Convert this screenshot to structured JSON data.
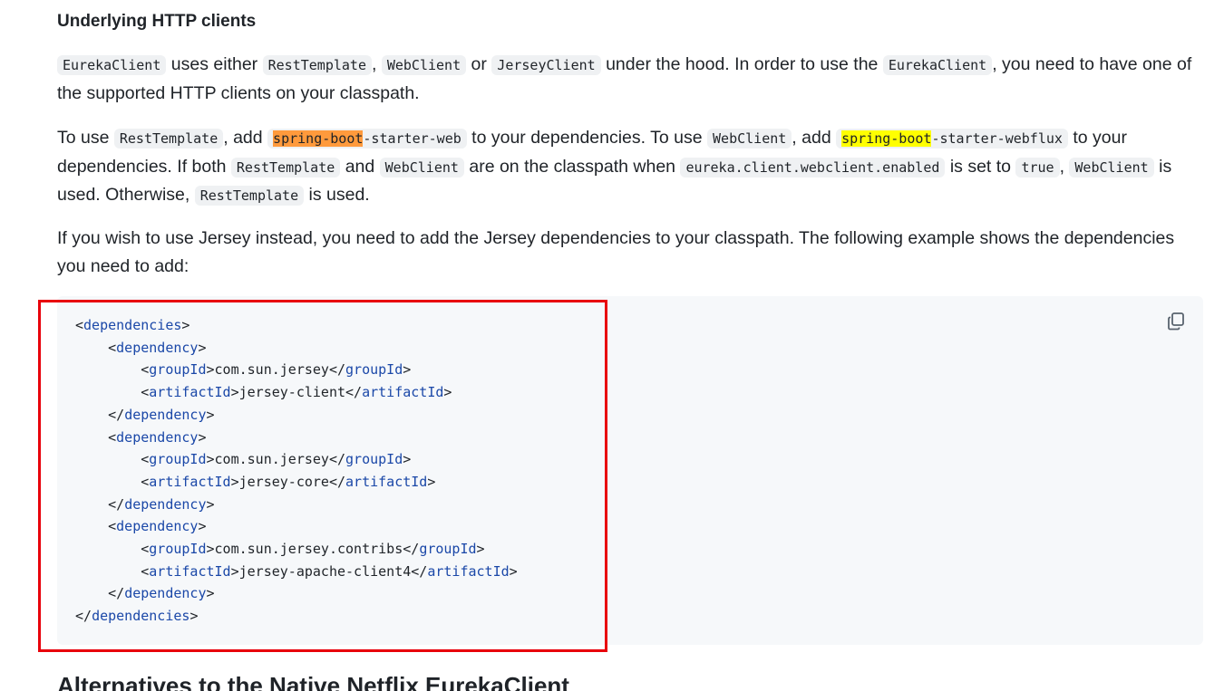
{
  "section_heading": "Underlying HTTP clients",
  "para1": {
    "code_eureka_client": "EurekaClient",
    "t1": " uses either ",
    "code_rest_template": "RestTemplate",
    "t2": ", ",
    "code_web_client": "WebClient",
    "t3": " or ",
    "code_jersey_client": "JerseyClient",
    "t4": " under the hood. In order to use the ",
    "code_eureka_client2": "EurekaClient",
    "t5": ", you need to have one of the supported HTTP clients on your classpath."
  },
  "para2": {
    "t1": "To use ",
    "code_rest_template": "RestTemplate",
    "t2": ", add ",
    "code_web_hl": "spring-boot",
    "code_web_rest": "-starter-web",
    "t3": " to your dependencies. To use ",
    "code_web_client": "WebClient",
    "t4": ", add ",
    "code_webflux_hl": "spring-boot",
    "code_webflux_rest": "-starter-webflux",
    "t5": " to your dependencies. If both ",
    "code_rest_template2": "RestTemplate",
    "t6": " and ",
    "code_web_client2": "WebClient",
    "t7": " are on the classpath when ",
    "code_property": "eureka.client.webclient.enabled",
    "t8": " is set to ",
    "code_true": "true",
    "t9": ", ",
    "code_web_client3": "WebClient",
    "t10": " is used. Otherwise, ",
    "code_rest_template3": "RestTemplate",
    "t11": " is used."
  },
  "para3": "If you wish to use Jersey instead, you need to add the Jersey dependencies to your classpath. The following example shows the dependencies you need to add:",
  "code_block": {
    "lines": [
      {
        "indent": "",
        "open": "<",
        "tag": "dependencies",
        "close": ">",
        "text": "",
        "open2": "",
        "tag2": "",
        "close2": ""
      },
      {
        "indent": "    ",
        "open": "<",
        "tag": "dependency",
        "close": ">",
        "text": "",
        "open2": "",
        "tag2": "",
        "close2": ""
      },
      {
        "indent": "        ",
        "open": "<",
        "tag": "groupId",
        "close": ">",
        "text": "com.sun.jersey",
        "open2": "</",
        "tag2": "groupId",
        "close2": ">"
      },
      {
        "indent": "        ",
        "open": "<",
        "tag": "artifactId",
        "close": ">",
        "text": "jersey-client",
        "open2": "</",
        "tag2": "artifactId",
        "close2": ">"
      },
      {
        "indent": "    ",
        "open": "</",
        "tag": "dependency",
        "close": ">",
        "text": "",
        "open2": "",
        "tag2": "",
        "close2": ""
      },
      {
        "indent": "    ",
        "open": "<",
        "tag": "dependency",
        "close": ">",
        "text": "",
        "open2": "",
        "tag2": "",
        "close2": ""
      },
      {
        "indent": "        ",
        "open": "<",
        "tag": "groupId",
        "close": ">",
        "text": "com.sun.jersey",
        "open2": "</",
        "tag2": "groupId",
        "close2": ">"
      },
      {
        "indent": "        ",
        "open": "<",
        "tag": "artifactId",
        "close": ">",
        "text": "jersey-core",
        "open2": "</",
        "tag2": "artifactId",
        "close2": ">"
      },
      {
        "indent": "    ",
        "open": "</",
        "tag": "dependency",
        "close": ">",
        "text": "",
        "open2": "",
        "tag2": "",
        "close2": ""
      },
      {
        "indent": "    ",
        "open": "<",
        "tag": "dependency",
        "close": ">",
        "text": "",
        "open2": "",
        "tag2": "",
        "close2": ""
      },
      {
        "indent": "        ",
        "open": "<",
        "tag": "groupId",
        "close": ">",
        "text": "com.sun.jersey.contribs",
        "open2": "</",
        "tag2": "groupId",
        "close2": ">"
      },
      {
        "indent": "        ",
        "open": "<",
        "tag": "artifactId",
        "close": ">",
        "text": "jersey-apache-client4",
        "open2": "</",
        "tag2": "artifactId",
        "close2": ">"
      },
      {
        "indent": "    ",
        "open": "</",
        "tag": "dependency",
        "close": ">",
        "text": "",
        "open2": "",
        "tag2": "",
        "close2": ""
      },
      {
        "indent": "",
        "open": "</",
        "tag": "dependencies",
        "close": ">",
        "text": "",
        "open2": "",
        "tag2": "",
        "close2": ""
      }
    ],
    "copy_icon": "copy-icon"
  },
  "annotation": {
    "color": "#e8000b"
  },
  "next_heading": "Alternatives to the Native Netflix EurekaClient"
}
